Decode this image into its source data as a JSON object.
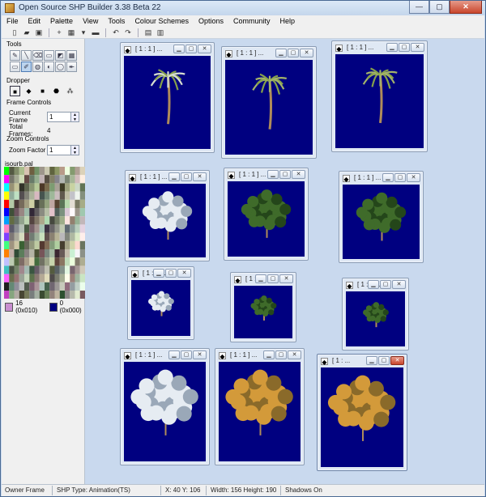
{
  "app": {
    "title": "Open Source SHP Builder 3.38 Beta 22",
    "caption_buttons": {
      "minimize": "—",
      "maximize": "▢",
      "close": "✕"
    }
  },
  "menu": [
    "File",
    "Edit",
    "Palette",
    "View",
    "Tools",
    "Colour Schemes",
    "Options",
    "Community",
    "Help"
  ],
  "toolbar": {
    "buttons": [
      "new-icon",
      "open-icon",
      "save-icon",
      "crosshair-icon",
      "grid-icon",
      "chevron-down-icon",
      "flat-icon",
      "undo-icon",
      "redo-icon",
      "preview-icon",
      "book-icon"
    ],
    "glyphs": [
      "▯",
      "▰",
      "▣",
      "+",
      "▦",
      "▾",
      "▬",
      "↶",
      "↷",
      "▤",
      "▥"
    ]
  },
  "tools_panel": {
    "tools_label": "Tools",
    "tool_glyphs": [
      "✎",
      "╲",
      "⌫",
      "▭",
      "◩",
      "▦",
      "▭",
      "✐",
      "◍",
      "◐",
      "◯",
      "↞"
    ],
    "tool_names": [
      "pencil-icon",
      "line-icon",
      "eraser-icon",
      "rectangle-icon",
      "fill-rect-icon",
      "crop-icon",
      "select-rect-icon",
      "dropper-icon",
      "bucket-icon",
      "smudge-icon",
      "ellipse-icon",
      "brush-icon"
    ],
    "active_tool": 7,
    "dropper_label": "Dropper",
    "dropper_options": [
      "■",
      "◆",
      "■",
      "⬣",
      "⁂"
    ],
    "frame_controls_label": "Frame Controls",
    "current_frame_label": "Current Frame",
    "current_frame_value": "1",
    "total_frames_label": "Total Frames:",
    "total_frames_value": "4",
    "zoom_controls_label": "Zoom Controls",
    "zoom_factor_label": "Zoom Factor",
    "zoom_factor_value": "1",
    "palette_name": "isourb.pal",
    "left_color_label": "16 (0x010)",
    "left_color": "#c98fd0",
    "right_color_label": "0 (0x000)",
    "right_color": "#000080"
  },
  "windows_label": "[ 1 : 1 ] ...",
  "windows_label_short": "[ 1 : ...",
  "status": {
    "owner": "Owner Frame",
    "shp_type": "SHP Type: Animation(TS)",
    "coords": "X: 40 Y: 106",
    "size": "Width: 156 Height: 190",
    "shadows": "Shadows On"
  },
  "colors": {
    "canvas": "#000080",
    "palm_trunk": "#b08c5a",
    "palm_leaf_1": "#d6ddd0",
    "palm_leaf_2": "#a3b36a",
    "palm_leaf_3": "#86a04a",
    "tree_snow": "#e6ecf2",
    "tree_green": "#3f6b2a",
    "tree_autumn": "#d39a3a"
  }
}
